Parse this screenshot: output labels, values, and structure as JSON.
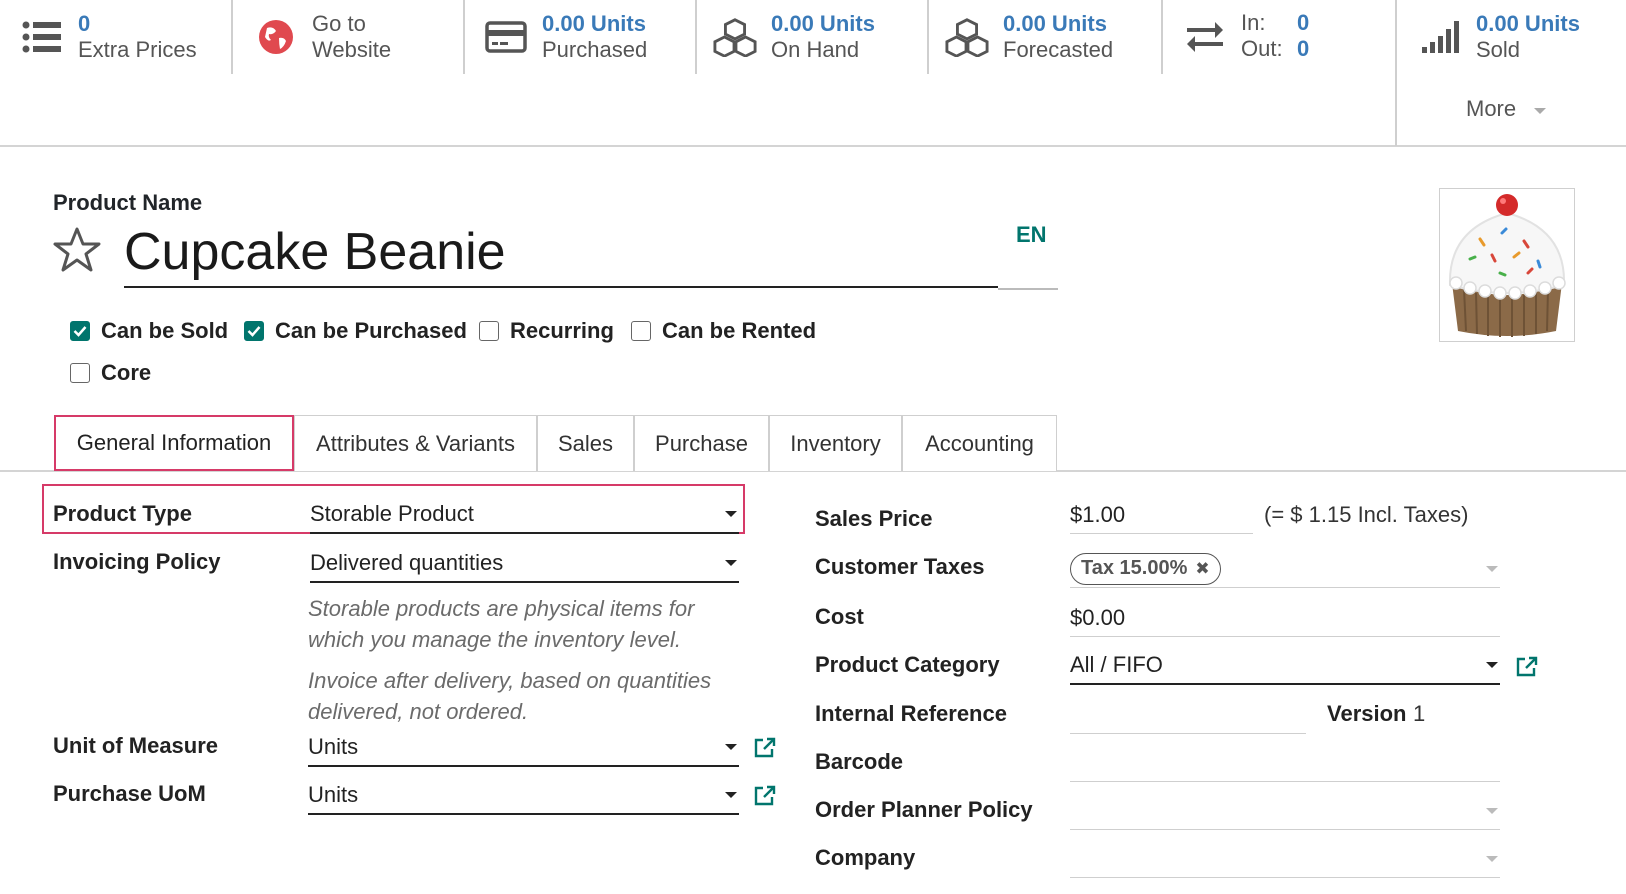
{
  "smart_buttons": {
    "extra_prices": {
      "value": "0",
      "label": "Extra Prices"
    },
    "website": {
      "line1": "Go to",
      "line2": "Website"
    },
    "purchased": {
      "value": "0.00 Units",
      "label": "Purchased"
    },
    "on_hand": {
      "value": "0.00 Units",
      "label": "On Hand"
    },
    "forecasted": {
      "value": "0.00 Units",
      "label": "Forecasted"
    },
    "in_out": {
      "in_label": "In:",
      "in_value": "0",
      "out_label": "Out:",
      "out_value": "0"
    },
    "sold": {
      "value": "0.00 Units",
      "label": "Sold"
    },
    "more": "More"
  },
  "header": {
    "product_name_label": "Product Name",
    "product_name": "Cupcake Beanie",
    "language": "EN"
  },
  "flags": {
    "can_be_sold": {
      "label": "Can be Sold",
      "checked": true
    },
    "can_be_purchased": {
      "label": "Can be Purchased",
      "checked": true
    },
    "recurring": {
      "label": "Recurring",
      "checked": false
    },
    "can_be_rented": {
      "label": "Can be Rented",
      "checked": false
    },
    "core": {
      "label": "Core",
      "checked": false
    }
  },
  "tabs": [
    {
      "label": "General Information",
      "active": true
    },
    {
      "label": "Attributes & Variants"
    },
    {
      "label": "Sales"
    },
    {
      "label": "Purchase"
    },
    {
      "label": "Inventory"
    },
    {
      "label": "Accounting"
    }
  ],
  "left_form": {
    "product_type": {
      "label": "Product Type",
      "value": "Storable Product"
    },
    "invoicing_policy": {
      "label": "Invoicing Policy",
      "value": "Delivered quantities"
    },
    "help_storable": "Storable products are physical items for which you manage the inventory level.",
    "help_invoice": "Invoice after delivery, based on quantities delivered, not ordered.",
    "uom": {
      "label": "Unit of Measure",
      "value": "Units"
    },
    "purchase_uom": {
      "label": "Purchase UoM",
      "value": "Units"
    }
  },
  "right_form": {
    "sales_price": {
      "label": "Sales Price",
      "value": "$1.00",
      "incl_taxes": "(= $ 1.15 Incl. Taxes)"
    },
    "customer_taxes": {
      "label": "Customer Taxes",
      "tag": "Tax 15.00%"
    },
    "cost": {
      "label": "Cost",
      "value": "$0.00"
    },
    "product_category": {
      "label": "Product Category",
      "value": "All / FIFO"
    },
    "internal_reference": {
      "label": "Internal Reference",
      "value": ""
    },
    "version": {
      "label": "Version",
      "value": "1"
    },
    "barcode": {
      "label": "Barcode",
      "value": ""
    },
    "order_planner_policy": {
      "label": "Order Planner Policy",
      "value": ""
    },
    "company": {
      "label": "Company",
      "value": ""
    }
  },
  "colors": {
    "accent": "#01756d",
    "link": "#3a7ab8",
    "highlight": "#d63a68"
  }
}
